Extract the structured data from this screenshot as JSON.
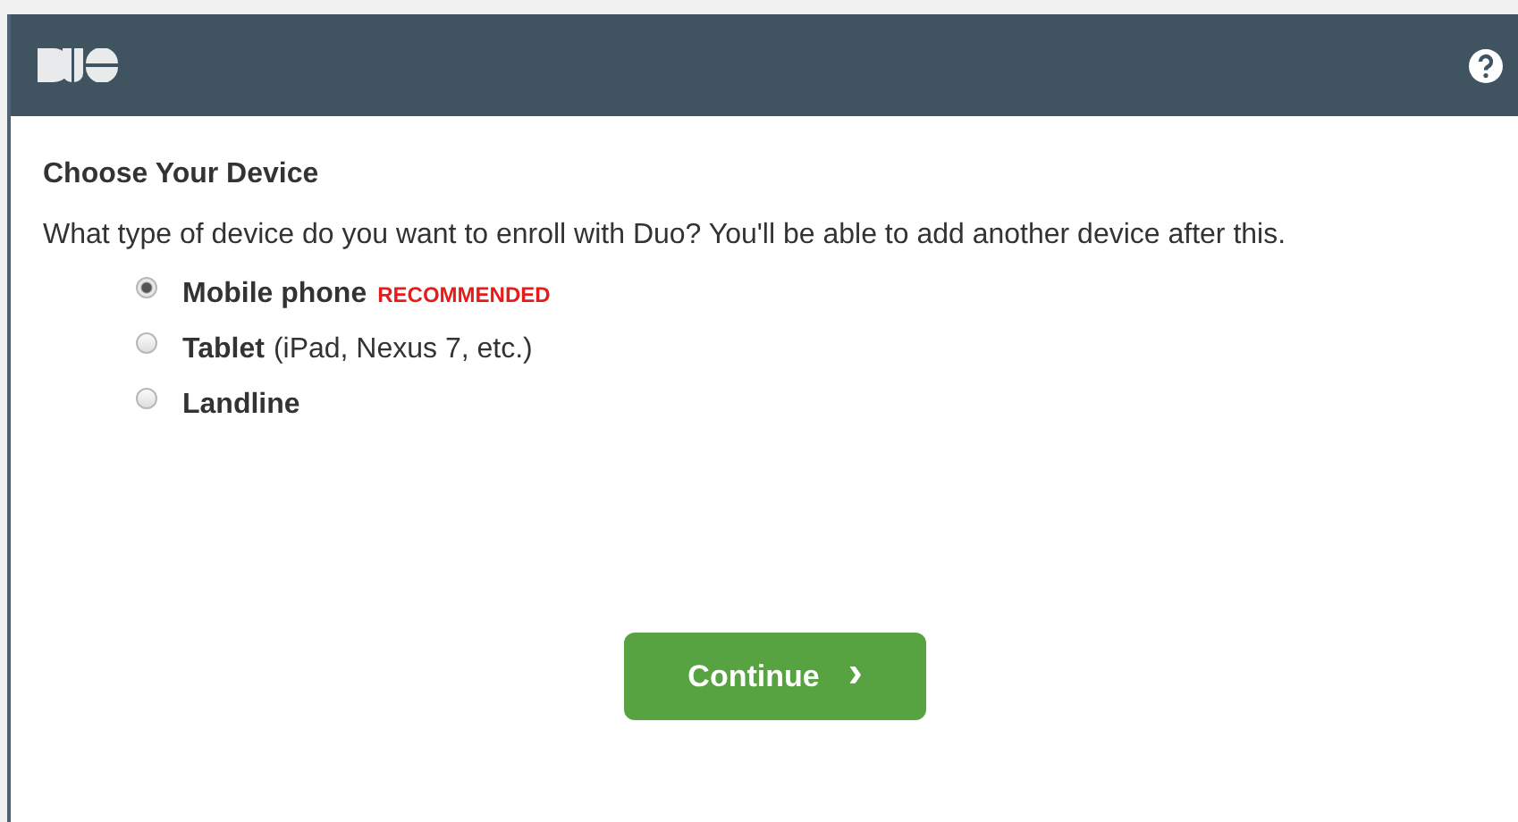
{
  "title": "Choose Your Device",
  "description": "What type of device do you want to enroll with Duo? You'll be able to add another device after this.",
  "options": [
    {
      "label": "Mobile phone",
      "badge": "RECOMMENDED",
      "selected": true
    },
    {
      "label": "Tablet",
      "note": "(iPad, Nexus 7, etc.)",
      "selected": false
    },
    {
      "label": "Landline",
      "selected": false
    }
  ],
  "button": {
    "label": "Continue",
    "icon": "›"
  }
}
